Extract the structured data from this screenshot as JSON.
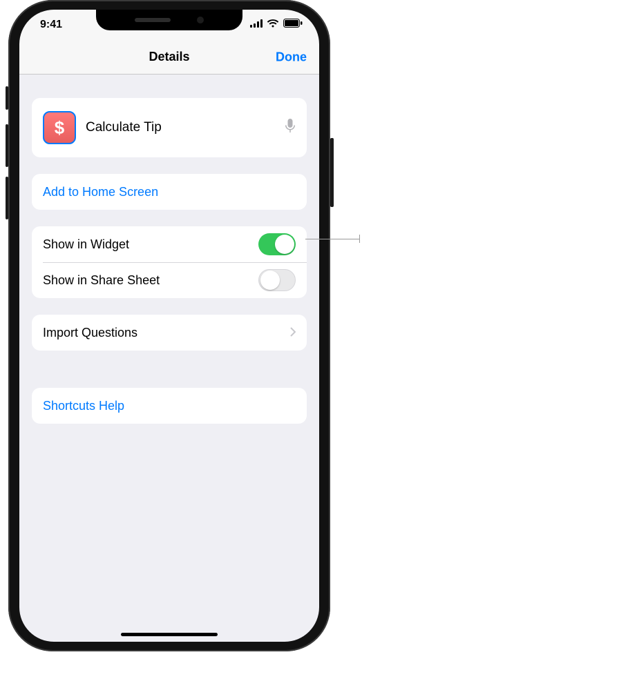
{
  "statusbar": {
    "time": "9:41"
  },
  "navbar": {
    "title": "Details",
    "done": "Done"
  },
  "shortcut": {
    "name": "Calculate Tip",
    "glyph": "$"
  },
  "actions": {
    "add_home": "Add to Home Screen",
    "widget_label": "Show in Widget",
    "widget_on": true,
    "share_label": "Show in Share Sheet",
    "share_on": false,
    "import_questions": "Import Questions",
    "help": "Shortcuts Help"
  }
}
